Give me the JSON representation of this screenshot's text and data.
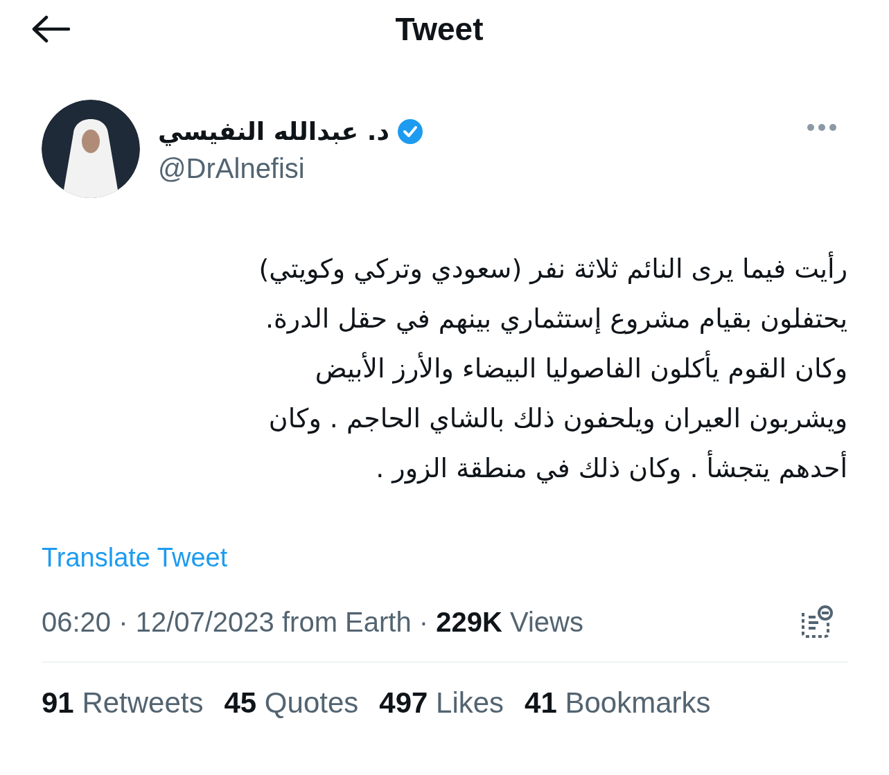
{
  "header": {
    "title": "Tweet"
  },
  "author": {
    "name": "د. عبدالله النفيسي",
    "verified": true,
    "handle": "@DrAlnefisi"
  },
  "tweet": {
    "text": "رأيت فيما يرى النائم ثلاثة نفر (سعودي وتركي وكويتي)\nيحتفلون بقيام مشروع إستثماري بينهم في حقل الدرة.\nوكان القوم يأكلون الفاصوليا البيضاء والأرز الأبيض\nويشربون العيران ويلحفون ذلك بالشاي الحاجم . وكان\nأحدهم يتجشأ . وكان ذلك في منطقة الزور .",
    "translate": "Translate Tweet",
    "meta": "06:20 · 12/07/2023 from Earth · **229K** Views"
  },
  "stats": {
    "retweets": {
      "count": "91",
      "label": "Retweets"
    },
    "quotes": {
      "count": "45",
      "label": "Quotes"
    },
    "likes": {
      "count": "497",
      "label": "Likes"
    },
    "bookmarks": {
      "count": "41",
      "label": "Bookmarks"
    }
  }
}
